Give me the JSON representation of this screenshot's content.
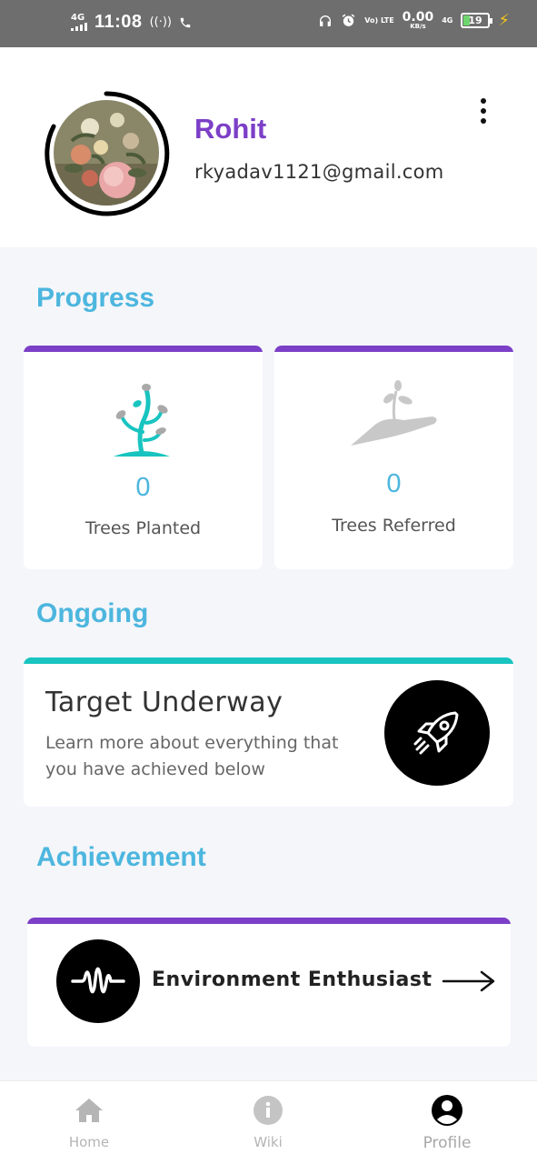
{
  "status_bar": {
    "network_left": "4G",
    "time": "11:08",
    "speed_value": "0.00",
    "speed_unit": "KB/s",
    "volte": "Vo) LTE",
    "network_right": "4G",
    "battery_level": "19",
    "colors": {
      "background": "#6e6e6e",
      "battery_fill": "#6fd66f",
      "charging": "#f5c518"
    }
  },
  "profile": {
    "name": "Rohit",
    "email": "rkyadav1121@gmail.com",
    "avatar_icon": "flower-painting",
    "menu_icon": "kebab-menu-icon",
    "colors": {
      "name": "#7c3fc7"
    }
  },
  "progress": {
    "title": "Progress",
    "cards": [
      {
        "value": "0",
        "label": "Trees Planted",
        "icon": "plant-icon",
        "accent": "#7c3fc7"
      },
      {
        "value": "0",
        "label": "Trees Referred",
        "icon": "hand-plant-icon",
        "accent": "#7c3fc7"
      }
    ]
  },
  "ongoing": {
    "title": "Ongoing",
    "card_title": "Target Underway",
    "card_description": "Learn more about everything that you have achieved below",
    "icon": "rocket-icon",
    "accent": "#19c4c0"
  },
  "achievement": {
    "title": "Achievement",
    "label": "Environment Enthusiast",
    "icon": "soundwave-icon",
    "arrow_icon": "arrow-right-icon",
    "accent": "#7c3fc7"
  },
  "bottom_nav": {
    "items": [
      {
        "label": "Home",
        "icon": "home-icon"
      },
      {
        "label": "Wiki",
        "icon": "info-icon"
      },
      {
        "label": "Profile",
        "icon": "account-circle-icon",
        "active": true
      }
    ]
  },
  "colors": {
    "section_title": "#4cb6de",
    "page_background": "#f4f6fa"
  }
}
